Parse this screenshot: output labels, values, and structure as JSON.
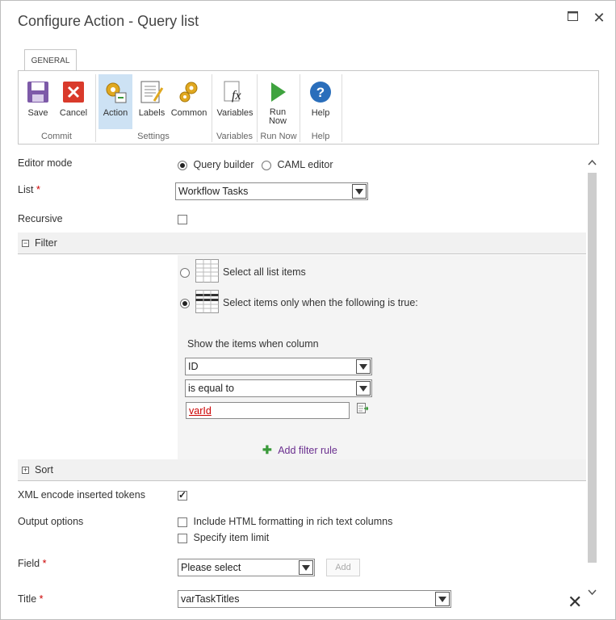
{
  "dialog": {
    "title": "Configure Action - Query list"
  },
  "ribbon": {
    "tab": "GENERAL",
    "buttons": {
      "save": "Save",
      "cancel": "Cancel",
      "action": "Action",
      "labels": "Labels",
      "common": "Common",
      "variables": "Variables",
      "run_now_1": "Run",
      "run_now_2": "Now",
      "help": "Help"
    },
    "groups": {
      "commit": "Commit",
      "settings": "Settings",
      "variables": "Variables",
      "run_now": "Run Now",
      "help": "Help"
    }
  },
  "form": {
    "editor_mode": {
      "label": "Editor mode",
      "option1": "Query builder",
      "option2": "CAML editor",
      "selected": "Query builder"
    },
    "list": {
      "label": "List",
      "required": "*",
      "value": "Workflow Tasks"
    },
    "recursive": {
      "label": "Recursive",
      "checked": false
    },
    "filter": {
      "title": "Filter",
      "toggle": "−",
      "opt_all": "Select all list items",
      "opt_cond": "Select items only when the following is true:",
      "show_when": "Show the items when column",
      "column": "ID",
      "operator": "is equal to",
      "value": "varId",
      "add_rule": "Add filter rule"
    },
    "sort": {
      "title": "Sort",
      "toggle": "+"
    },
    "xml_encode": {
      "label": "XML encode inserted tokens",
      "checked": true
    },
    "output_options": {
      "label": "Output options",
      "opt1": "Include HTML formatting in rich text columns",
      "opt2": "Specify item limit"
    },
    "field": {
      "label": "Field",
      "required": "*",
      "value": "Please select",
      "add": "Add"
    },
    "title_field": {
      "label": "Title",
      "required": "*",
      "value": "varTaskTitles"
    }
  },
  "colors": {
    "accent": "#cde2f4",
    "link": "#6a2f8f",
    "required": "#cc0000",
    "add_icon": "#3a9a3a"
  }
}
